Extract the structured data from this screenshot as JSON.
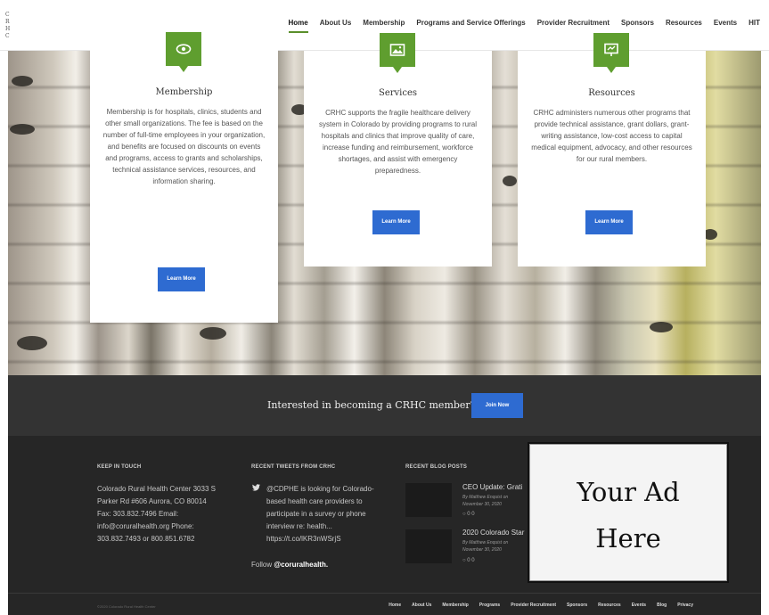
{
  "logo": {
    "letters": [
      "C",
      "R",
      "H",
      "C"
    ]
  },
  "nav": {
    "items": [
      "Home",
      "About Us",
      "Membership",
      "Programs and Service Offerings",
      "Provider Recruitment",
      "Sponsors",
      "Resources",
      "Events",
      "HIT"
    ],
    "active": "Home"
  },
  "cards": [
    {
      "icon": "eye-icon",
      "title": "Membership",
      "body": "Membership is for hospitals, clinics, students and other small organizations. The fee is based on the number of full-time employees in your organization, and benefits are focused on discounts on events and programs, access to grants and scholarships, technical assistance services, resources, and information sharing.",
      "button": "Learn More"
    },
    {
      "icon": "image-icon",
      "title": "Services",
      "body": "CRHC supports the fragile healthcare delivery system in Colorado by providing programs to rural hospitals and clinics that improve quality of care, increase funding and reimbursement, workforce shortages, and assist with emergency preparedness.",
      "button": "Learn More"
    },
    {
      "icon": "presentation-icon",
      "title": "Resources",
      "body": "CRHC administers numerous other programs that provide technical assistance, grant dollars, grant-writing assistance, low-cost access to capital medical equipment, advocacy, and other resources for our rural members.",
      "button": "Learn More"
    }
  ],
  "cta": {
    "text": "Interested in becoming a CRHC member?",
    "button": "Join Now"
  },
  "footer": {
    "keep_in_touch": {
      "heading": "KEEP IN TOUCH",
      "lines": [
        "Colorado Rural Health Center 3033 S",
        "Parker Rd #606 Aurora, CO 80014",
        "Fax: 303.832.7496 Email:",
        "info@coruralhealth.org Phone:",
        "303.832.7493 or 800.851.6782"
      ]
    },
    "tweets": {
      "heading": "RECENT TWEETS FROM CRHC",
      "lines": [
        "@CDPHE is looking for Colorado-",
        "based health care providers to",
        "participate in a survey or phone",
        "interview re: health...",
        "https://t.co/lKR3nWSrjS"
      ],
      "follow_prefix": "Follow",
      "follow_handle": "@coruralhealth."
    },
    "blog": {
      "heading": "RECENT BLOG POSTS",
      "posts": [
        {
          "title": "CEO Update: Grati",
          "author": "By Matthew Enquist on",
          "date": "November 30, 2020",
          "counts": "0 0"
        },
        {
          "title": "2020 Colorado Star",
          "author": "By Matthew Enquist on",
          "date": "November 30, 2020",
          "counts": "0 0"
        }
      ]
    },
    "copyright": "©2020 Colorado Rural Health Center",
    "nav": [
      "Home",
      "About Us",
      "Membership",
      "Programs",
      "Provider Recruitment",
      "Sponsors",
      "Resources",
      "Events",
      "Blog",
      "Privacy"
    ]
  },
  "ad": {
    "line1": "Your Ad",
    "line2": "Here"
  },
  "colors": {
    "accent_green": "#5f9e2f",
    "button_blue": "#2e6bd1",
    "footer_bg": "#262626",
    "cta_bg": "#333333"
  }
}
